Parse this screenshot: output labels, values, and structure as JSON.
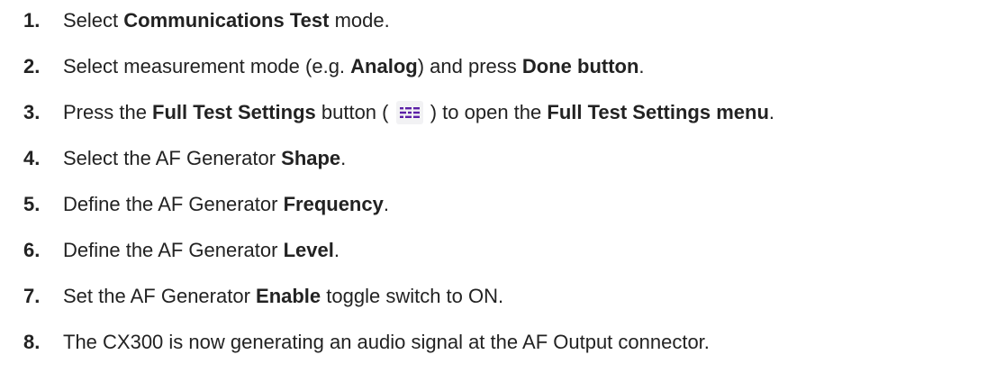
{
  "steps": [
    {
      "num": "1.",
      "t1": "Select ",
      "b1": "Communications Test",
      "t2": " mode."
    },
    {
      "num": "2.",
      "t1": "Select measurement mode (e.g. ",
      "b1": "Analog",
      "t2": ") and press ",
      "b2": "Done button",
      "t3": "."
    },
    {
      "num": "3.",
      "t1": "Press the ",
      "b1": "Full Test Settings",
      "t2": " button ( ",
      "icon": "full-test-settings-icon",
      "t3": " ) to open the ",
      "b2": "Full Test Settings menu",
      "t4": "."
    },
    {
      "num": "4.",
      "t1": "Select the AF Generator ",
      "b1": "Shape",
      "t2": "."
    },
    {
      "num": "5.",
      "t1": "Define the AF Generator ",
      "b1": "Frequency",
      "t2": "."
    },
    {
      "num": "6.",
      "t1": "Define the AF Generator ",
      "b1": "Level",
      "t2": "."
    },
    {
      "num": "7.",
      "t1": "Set the AF Generator ",
      "b1": "Enable",
      "t2": " toggle switch to ON."
    },
    {
      "num": "8.",
      "t1": "The CX300 is now generating an audio signal at the AF Output connector."
    }
  ],
  "colors": {
    "text": "#222222",
    "icon": "#5b1fa6",
    "icon_background": "#f2f2f4"
  }
}
